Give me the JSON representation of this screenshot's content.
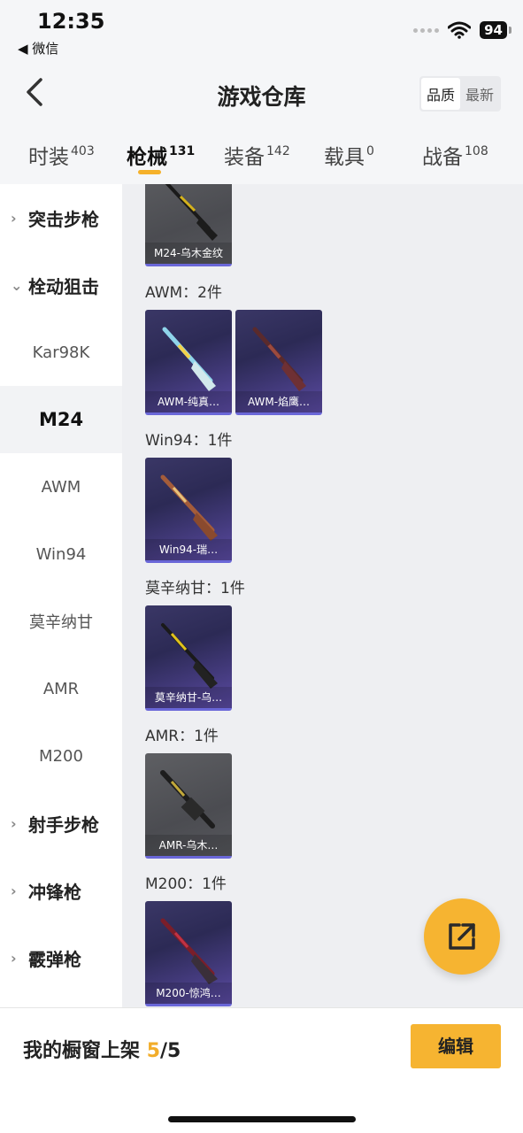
{
  "status_bar": {
    "time": "12:35",
    "back_app": "◀ 微信",
    "battery": "94"
  },
  "header": {
    "title": "游戏仓库",
    "sort_options": [
      "品质",
      "最新"
    ]
  },
  "tabs": [
    {
      "label": "时装",
      "count": "403"
    },
    {
      "label": "枪械",
      "count": "131"
    },
    {
      "label": "装备",
      "count": "142"
    },
    {
      "label": "载具",
      "count": "0"
    },
    {
      "label": "战备",
      "count": "108"
    }
  ],
  "sidebar": {
    "items": [
      {
        "label": "突击步枪",
        "chev": "›"
      },
      {
        "label": "栓动狙击",
        "chev": "⌄"
      },
      {
        "label": "Kar98K"
      },
      {
        "label": "M24"
      },
      {
        "label": "AWM"
      },
      {
        "label": "Win94"
      },
      {
        "label": "莫辛纳甘"
      },
      {
        "label": "AMR"
      },
      {
        "label": "M200"
      },
      {
        "label": "射手步枪",
        "chev": "›"
      },
      {
        "label": "冲锋枪",
        "chev": "›"
      },
      {
        "label": "霰弹枪",
        "chev": "›"
      }
    ]
  },
  "content": {
    "sections": [
      {
        "label": "AWM：2件"
      },
      {
        "label": "Win94：1件"
      },
      {
        "label": "莫辛纳甘：1件"
      },
      {
        "label": "AMR：1件"
      },
      {
        "label": "M200：1件"
      }
    ],
    "cards": [
      {
        "label": "M24-乌木金纹"
      },
      {
        "label": "AWM-纯真…"
      },
      {
        "label": "AWM-焰鹰…"
      },
      {
        "label": "Win94-瑞…"
      },
      {
        "label": "莫辛纳甘-乌…"
      },
      {
        "label": "AMR-乌木…"
      },
      {
        "label": "M200-惊鸿…"
      }
    ]
  },
  "bottom": {
    "shelf_label": "我的橱窗上架",
    "shelf_current": "5",
    "shelf_total": "/5",
    "edit_label": "编辑"
  },
  "colors": {
    "accent": "#f6b431",
    "card_purple": "#3a3766",
    "card_gray": "#5e5f63"
  }
}
